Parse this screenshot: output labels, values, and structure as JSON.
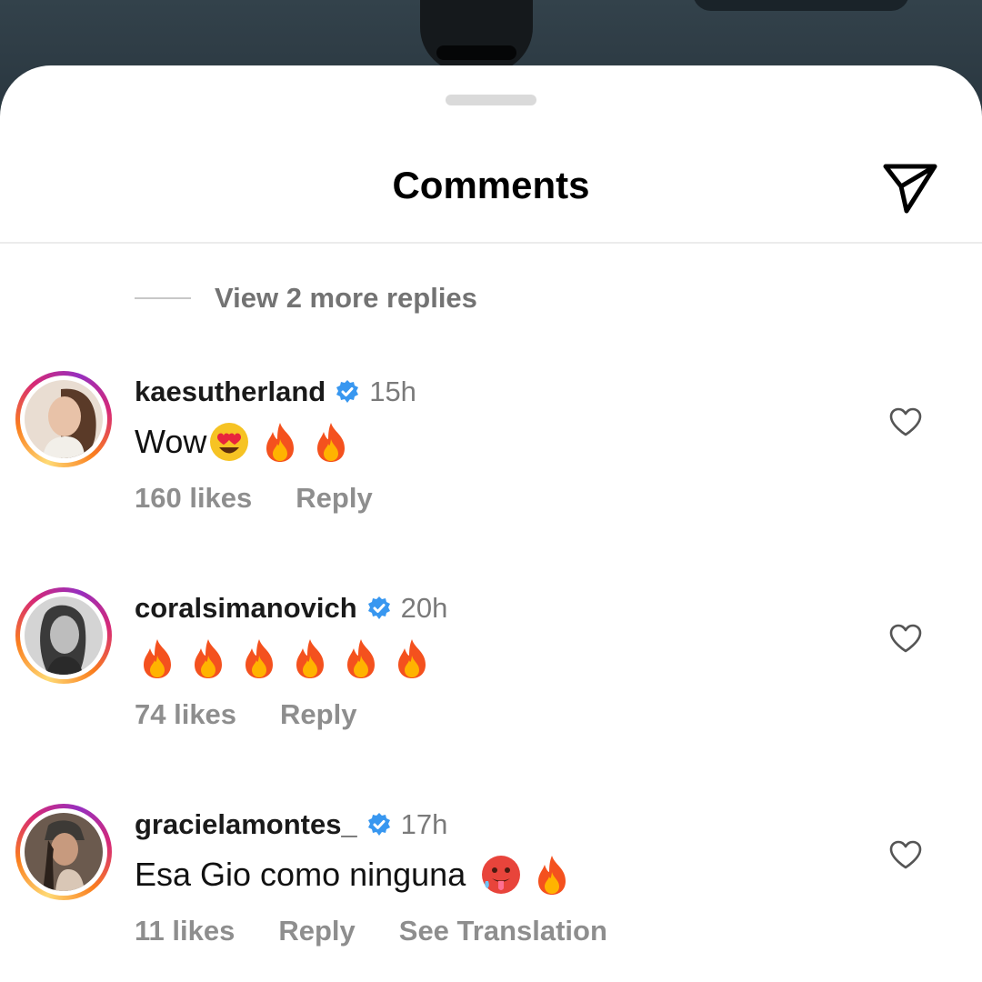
{
  "sheet": {
    "title": "Comments",
    "icons": {
      "share": "paper-plane-icon",
      "grabber": "drag-handle"
    }
  },
  "thread": {
    "view_replies_label": "View 2 more replies"
  },
  "comments": [
    {
      "username": "kaesutherland",
      "verified": true,
      "time": "15h",
      "text": "Wow",
      "emojis": [
        "heart-eyes-emoji",
        "fire-emoji",
        "fire-emoji"
      ],
      "likes": "160 likes",
      "reply_label": "Reply",
      "liked": false
    },
    {
      "username": "coralsimanovich",
      "verified": true,
      "time": "20h",
      "text": "",
      "emojis": [
        "fire-emoji",
        "fire-emoji",
        "fire-emoji",
        "fire-emoji",
        "fire-emoji",
        "fire-emoji"
      ],
      "likes": "74 likes",
      "reply_label": "Reply",
      "liked": false
    },
    {
      "username": "gracielamontes_",
      "verified": true,
      "time": "17h",
      "text": "Esa Gio como ninguna",
      "emojis": [
        "hot-face-emoji",
        "fire-emoji"
      ],
      "likes": "11 likes",
      "reply_label": "Reply",
      "translate_label": "See Translation",
      "liked": false
    }
  ],
  "colors": {
    "verified_badge": "#3897f0",
    "secondary_text": "#8e8e8e",
    "story_ring": [
      "#feda75",
      "#fa7e1e",
      "#d62976",
      "#962fbf"
    ]
  }
}
